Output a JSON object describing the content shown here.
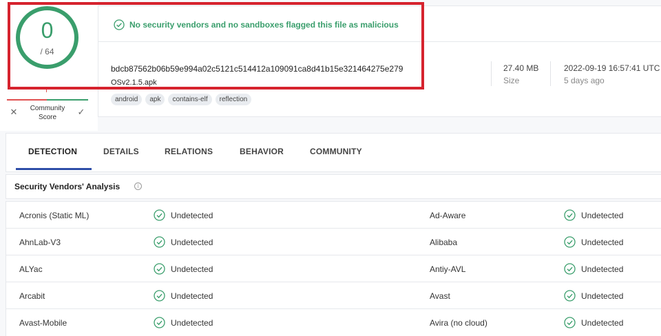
{
  "score": {
    "detections": "0",
    "total": "/ 64",
    "community_label_line1": "Community",
    "community_label_line2": "Score"
  },
  "header": {
    "status_message": "No security vendors and no sandboxes flagged this file as malicious",
    "hash": "bdcb87562b06b59e994a02c5121c514412a109091ca8d41b15e321464275e279",
    "file_name": "OSv2.1.5.apk",
    "tags": [
      "android",
      "apk",
      "contains-elf",
      "reflection"
    ],
    "size_value": "27.40 MB",
    "size_label": "Size",
    "date_value": "2022-09-19 16:57:41 UTC",
    "date_label": "5 days ago"
  },
  "tabs": [
    "DETECTION",
    "DETAILS",
    "RELATIONS",
    "BEHAVIOR",
    "COMMUNITY"
  ],
  "active_tab": "DETECTION",
  "section": {
    "title": "Security Vendors' Analysis"
  },
  "vendors": [
    {
      "left": {
        "name": "Acronis (Static ML)",
        "status": "Undetected"
      },
      "right": {
        "name": "Ad-Aware",
        "status": "Undetected"
      }
    },
    {
      "left": {
        "name": "AhnLab-V3",
        "status": "Undetected"
      },
      "right": {
        "name": "Alibaba",
        "status": "Undetected"
      }
    },
    {
      "left": {
        "name": "ALYac",
        "status": "Undetected"
      },
      "right": {
        "name": "Antiy-AVL",
        "status": "Undetected"
      }
    },
    {
      "left": {
        "name": "Arcabit",
        "status": "Undetected"
      },
      "right": {
        "name": "Avast",
        "status": "Undetected"
      }
    },
    {
      "left": {
        "name": "Avast-Mobile",
        "status": "Undetected"
      },
      "right": {
        "name": "Avira (no cloud)",
        "status": "Undetected"
      }
    }
  ],
  "colors": {
    "clean": "#3a9e6c",
    "highlight": "#d6232e",
    "tab_accent": "#2e4ea8"
  }
}
